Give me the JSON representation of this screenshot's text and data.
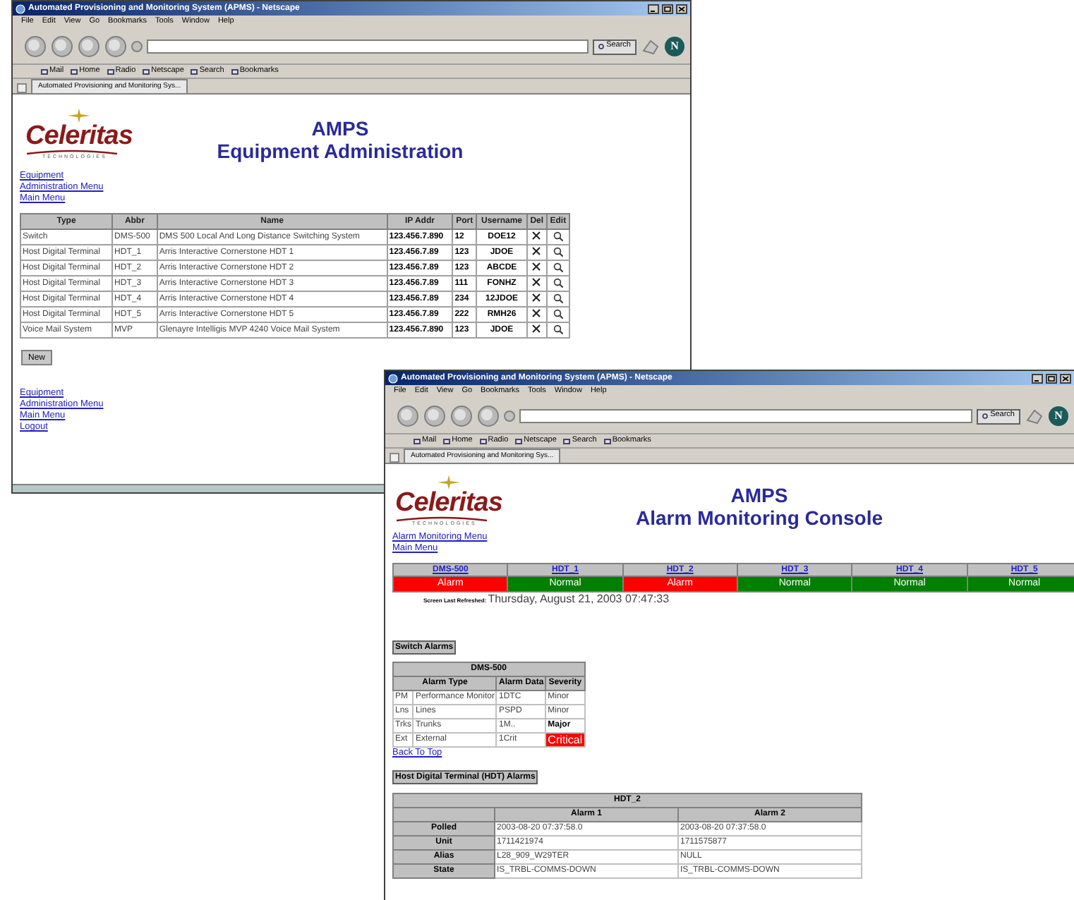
{
  "equipment_window": {
    "browser": {
      "title": "Automated Provisioning and Monitoring System (APMS) - Netscape",
      "menu": [
        "File",
        "Edit",
        "View",
        "Go",
        "Bookmarks",
        "Tools",
        "Window",
        "Help"
      ],
      "search_button": "Search",
      "logo_letter": "N",
      "bookmarks": [
        "Mail",
        "Home",
        "Radio",
        "Netscape",
        "Search",
        "Bookmarks"
      ],
      "tab": "Automated Provisioning and Monitoring Sys..."
    },
    "page": {
      "logo": {
        "name": "Celeritas",
        "tagline": "TECHNOLOGIES"
      },
      "heading": [
        "AMPS",
        "Equipment Administration"
      ],
      "top_links": [
        "Equipment",
        "Administration Menu",
        "Main Menu"
      ],
      "table": {
        "columns": [
          "Type",
          "Abbr",
          "Name",
          "IP Addr",
          "Port",
          "Username",
          "Del",
          "Edit"
        ],
        "rows": [
          [
            "Switch",
            "DMS-500",
            "DMS 500 Local And Long Distance Switching System",
            "123.456.7.890",
            "12",
            "DOE12"
          ],
          [
            "Host Digital Terminal",
            "HDT_1",
            "Arris Interactive Cornerstone HDT 1",
            "123.456.7.89",
            "123",
            "JDOE"
          ],
          [
            "Host Digital Terminal",
            "HDT_2",
            "Arris Interactive Cornerstone HDT 2",
            "123.456.7.89",
            "123",
            "ABCDE"
          ],
          [
            "Host Digital Terminal",
            "HDT_3",
            "Arris Interactive Cornerstone HDT 3",
            "123.456.7.89",
            "111",
            "FONHZ"
          ],
          [
            "Host Digital Terminal",
            "HDT_4",
            "Arris Interactive Cornerstone HDT 4",
            "123.456.7.89",
            "234",
            "12JDOE"
          ],
          [
            "Host Digital Terminal",
            "HDT_5",
            "Arris Interactive Cornerstone HDT 5",
            "123.456.7.89",
            "222",
            "RMH26"
          ],
          [
            "Voice Mail System",
            "MVP",
            "Glenayre Intelligis MVP 4240 Voice Mail System",
            "123.456.7.890",
            "123",
            "JDOE"
          ]
        ]
      },
      "new_button": "New",
      "bottom_links": [
        "Equipment",
        "Administration Menu",
        "Main Menu",
        "Logout"
      ]
    }
  },
  "alarm_window": {
    "browser": {
      "title": "Automated Provisioning and Monitoring System (APMS) - Netscape",
      "menu": [
        "File",
        "Edit",
        "View",
        "Go",
        "Bookmarks",
        "Tools",
        "Window",
        "Help"
      ],
      "search_button": "Search",
      "logo_letter": "N",
      "bookmarks": [
        "Mail",
        "Home",
        "Radio",
        "Netscape",
        "Search",
        "Bookmarks"
      ],
      "tab": "Automated Provisioning and Monitoring Sys..."
    },
    "page": {
      "logo": {
        "name": "Celeritas",
        "tagline": "TECHNOLOGIES"
      },
      "heading": [
        "AMPS",
        "Alarm Monitoring Console"
      ],
      "top_links": [
        "Alarm Monitoring Menu",
        "Main Menu"
      ],
      "devices": [
        {
          "name": "DMS-500",
          "status": "Alarm",
          "alarm": true
        },
        {
          "name": "HDT_1",
          "status": "Normal",
          "alarm": false
        },
        {
          "name": "HDT_2",
          "status": "Alarm",
          "alarm": true
        },
        {
          "name": "HDT_3",
          "status": "Normal",
          "alarm": false
        },
        {
          "name": "HDT_4",
          "status": "Normal",
          "alarm": false
        },
        {
          "name": "HDT_5",
          "status": "Normal",
          "alarm": false
        }
      ],
      "refreshed_label": "Screen Last Refreshed:",
      "refreshed": "Thursday, August 21, 2003 07:47:33",
      "switch_heading": "Switch Alarms",
      "switch_table": {
        "title": "DMS-500",
        "columns": [
          "Alarm Type",
          "Alarm Data",
          "Severity"
        ],
        "rows": [
          {
            "code": "PM",
            "type": "Performance Monitor",
            "data": "1DTC",
            "severity": "Minor",
            "kind": "minor"
          },
          {
            "code": "Lns",
            "type": "Lines",
            "data": "PSPD",
            "severity": "Minor",
            "kind": "minor"
          },
          {
            "code": "Trks",
            "type": "Trunks",
            "data": "1M..",
            "severity": "Major",
            "kind": "major"
          },
          {
            "code": "Ext",
            "type": "External",
            "data": "1Crit",
            "severity": "Critical",
            "kind": "critical"
          }
        ]
      },
      "back_to_top": "Back To Top",
      "hdt_heading": "Host Digital Terminal (HDT) Alarms",
      "hdt_table": {
        "title": "HDT_2",
        "columns": [
          "Alarm 1",
          "Alarm 2"
        ],
        "rows": [
          {
            "label": "Polled",
            "values": [
              "2003-08-20 07:37:58.0",
              "2003-08-20 07:37:58.0"
            ]
          },
          {
            "label": "Unit",
            "values": [
              "1711421974",
              "1711575877"
            ]
          },
          {
            "label": "Alias",
            "values": [
              "L28_909_W29TER",
              "NULL"
            ]
          },
          {
            "label": "State",
            "values": [
              "IS_TRBL-COMMS-DOWN",
              "IS_TRBL-COMMS-DOWN"
            ]
          }
        ]
      }
    }
  }
}
